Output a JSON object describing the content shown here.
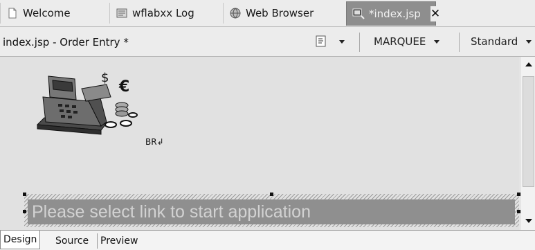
{
  "editor_tabs": [
    {
      "label": "Welcome",
      "icon": "page-icon"
    },
    {
      "label": "wflabxx Log",
      "icon": "log-icon"
    },
    {
      "label": "Web Browser",
      "icon": "browser-icon"
    },
    {
      "label": "*index.jsp",
      "icon": "jsp-file-icon",
      "active": true
    }
  ],
  "toolbar": {
    "page_title": "index.jsp - Order Entry *",
    "marquee_combo": "MARQUEE",
    "style_combo": "Standard"
  },
  "canvas": {
    "br_marker": "BR",
    "marquee_text": "Please select link to start application"
  },
  "page_tabs": [
    "Design",
    "Source",
    "Preview"
  ],
  "colors": {
    "canvas_bg": "#e1e1e1",
    "marquee_bg": "#8f8f8f",
    "active_tab_bg": "#8e8e8e"
  }
}
